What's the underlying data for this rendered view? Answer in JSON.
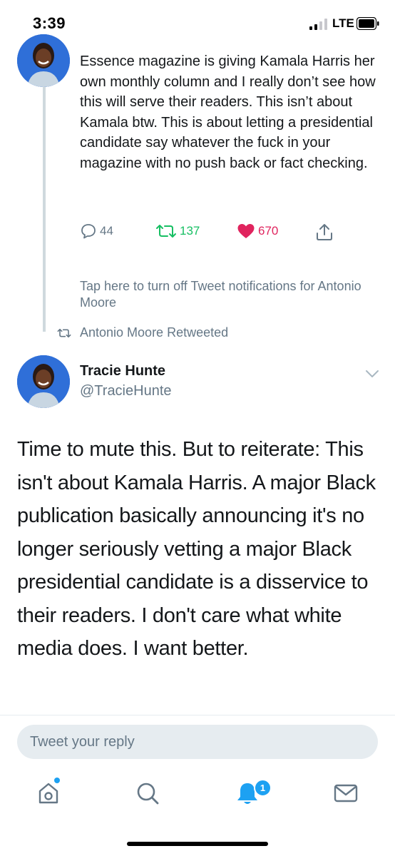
{
  "status_bar": {
    "time": "3:39",
    "network": "LTE"
  },
  "thread_tweet": {
    "text": "Essence magazine is giving Kamala Harris her own monthly column and I really don’t see how this will serve their readers. This isn’t about Kamala btw. This is about letting a presidential candidate say whatever the fuck in your magazine with no push back or fact checking.",
    "replies": "44",
    "retweets": "137",
    "likes": "670"
  },
  "notification_prompt": "Tap here to turn off Tweet notifications for Antonio Moore",
  "retweeted_by": "Antonio Moore Retweeted",
  "main_tweet": {
    "author_name": "Tracie Hunte",
    "author_handle": "@TracieHunte",
    "text": "Time to mute this. But to reiterate: This isn't about Kamala Harris. A major Black publication basically announcing it's no longer seriously vetting a major Black presidential candidate is a disservice to their readers. I don't care what white media does. I want better."
  },
  "reply_box": {
    "placeholder": "Tweet your reply"
  },
  "tab_bar": {
    "items": [
      "home-icon",
      "search-icon",
      "notifications-icon",
      "messages-icon"
    ],
    "notifications_badge": "1"
  },
  "colors": {
    "accent": "#1da1f2",
    "retweet": "#17bf63",
    "like": "#e0245e",
    "muted": "#657786",
    "avatar_bg": "#2f6fd8"
  }
}
